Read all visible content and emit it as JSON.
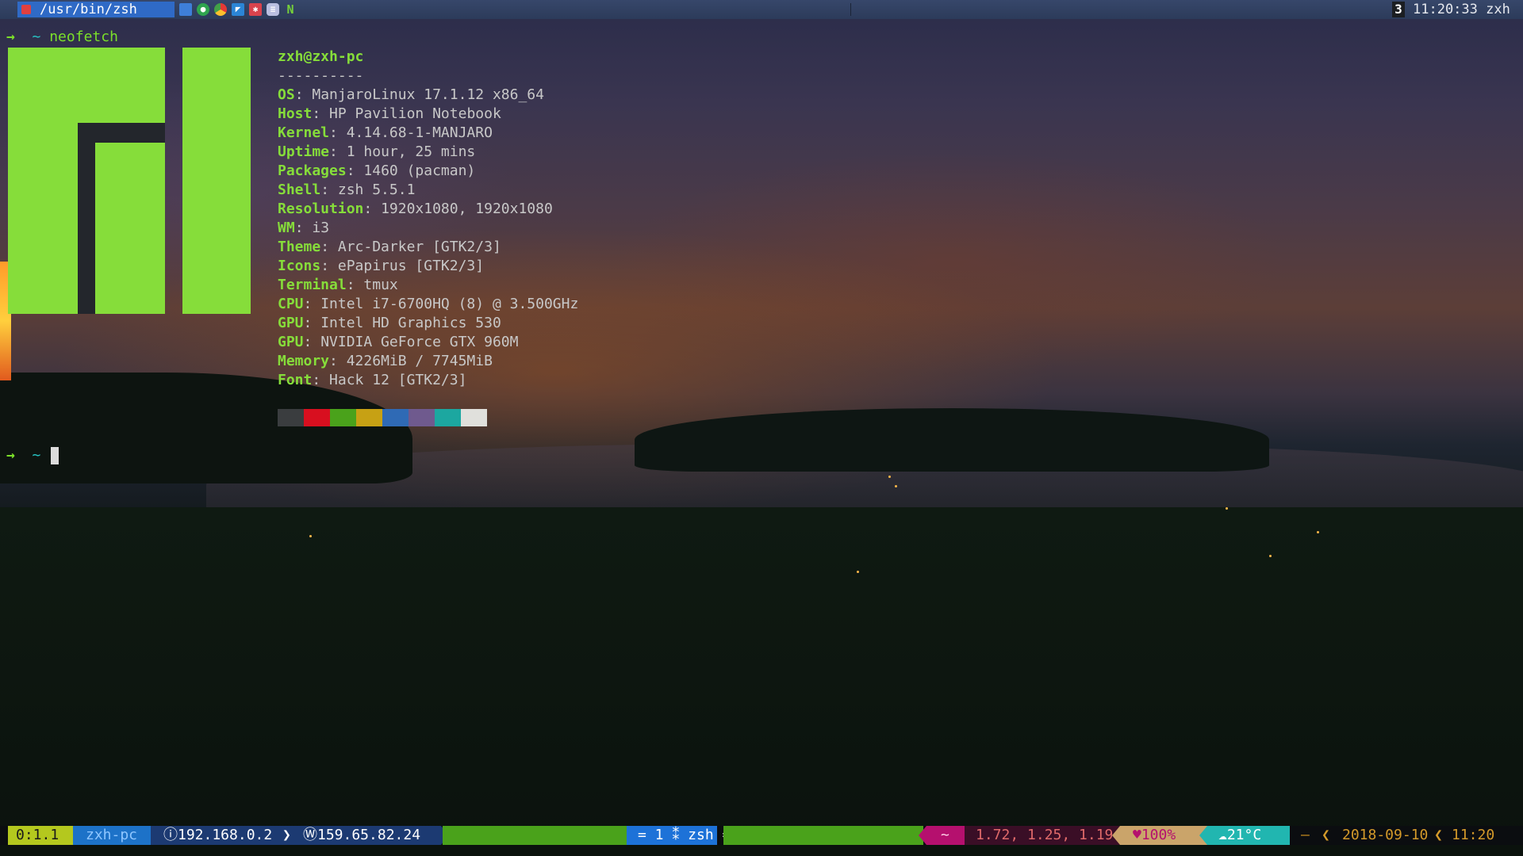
{
  "topbar": {
    "window_title": "/usr/bin/zsh",
    "tray_icons": [
      "window-icon",
      "hangouts-icon",
      "chrome-icon",
      "vscode-icon",
      "redmine-icon",
      "network-icon",
      "nvidia-icon"
    ],
    "workspace_number": "3",
    "clock": "11:20:33 zxh"
  },
  "terminal": {
    "prompt_arrow": "→",
    "prompt_tilde": "~",
    "command": "neofetch",
    "title_line": "zxh@zxh-pc",
    "separator": "----------",
    "info": [
      {
        "key": "OS",
        "value": "ManjaroLinux 17.1.12 x86_64"
      },
      {
        "key": "Host",
        "value": "HP Pavilion Notebook"
      },
      {
        "key": "Kernel",
        "value": "4.14.68-1-MANJARO"
      },
      {
        "key": "Uptime",
        "value": "1 hour, 25 mins"
      },
      {
        "key": "Packages",
        "value": "1460 (pacman)"
      },
      {
        "key": "Shell",
        "value": "zsh 5.5.1"
      },
      {
        "key": "Resolution",
        "value": "1920x1080, 1920x1080"
      },
      {
        "key": "WM",
        "value": "i3"
      },
      {
        "key": "Theme",
        "value": "Arc-Darker [GTK2/3]"
      },
      {
        "key": "Icons",
        "value": "ePapirus [GTK2/3]"
      },
      {
        "key": "Terminal",
        "value": "tmux"
      },
      {
        "key": "CPU",
        "value": "Intel i7-6700HQ (8) @ 3.500GHz"
      },
      {
        "key": "GPU",
        "value": "Intel HD Graphics 530"
      },
      {
        "key": "GPU",
        "value": "NVIDIA GeForce GTX 960M"
      },
      {
        "key": "Memory",
        "value": "4226MiB / 7745MiB"
      },
      {
        "key": "Font",
        "value": "Hack 12 [GTK2/3]"
      }
    ],
    "palette": [
      "#3a3d3f",
      "#d80f1f",
      "#4aa21b",
      "#c7a114",
      "#2f6ab5",
      "#6f5a8e",
      "#1ca7a0",
      "#e0e0dc"
    ],
    "logo_color": "#86dd3a"
  },
  "statusline": {
    "session": "0:1.1",
    "host": "zxh-pc",
    "lan_ip": "ⓘ192.168.0.2",
    "wan_ip": "Ⓦ159.65.82.24",
    "window": "= 1 ⁑ zsh =",
    "tilde": "~",
    "load": "1.72, 1.25, 1.19",
    "battery": "♥100%",
    "weather": "☁21°C",
    "dash": "—",
    "date": "2018-09-10",
    "time": "11:20"
  }
}
